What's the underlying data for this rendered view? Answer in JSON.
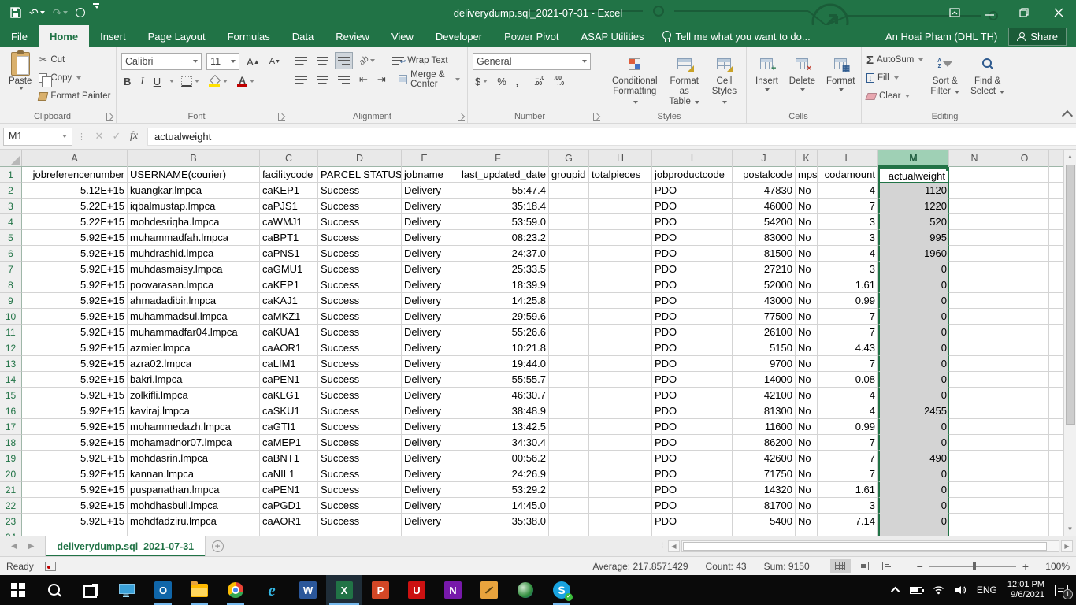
{
  "titlebar": {
    "title": "deliverydump.sql_2021-07-31 - Excel"
  },
  "menubar": {
    "tabs": [
      "File",
      "Home",
      "Insert",
      "Page Layout",
      "Formulas",
      "Data",
      "Review",
      "View",
      "Developer",
      "Power Pivot",
      "ASAP Utilities"
    ],
    "active_tab": "Home",
    "tell_me": "Tell me what you want to do...",
    "user_name": "An Hoai Pham (DHL TH)",
    "share_label": "Share"
  },
  "ribbon": {
    "clipboard": {
      "label": "Clipboard",
      "paste": "Paste",
      "cut": "Cut",
      "copy": "Copy",
      "format_painter": "Format Painter"
    },
    "font": {
      "label": "Font",
      "family": "Calibri",
      "size": "11"
    },
    "alignment": {
      "label": "Alignment",
      "wrap_text": "Wrap Text",
      "merge_center": "Merge & Center"
    },
    "number": {
      "label": "Number",
      "format": "General"
    },
    "styles": {
      "label": "Styles",
      "items": [
        {
          "l1": "Conditional",
          "l2": "Formatting"
        },
        {
          "l1": "Format as",
          "l2": "Table"
        },
        {
          "l1": "Cell",
          "l2": "Styles"
        }
      ]
    },
    "cells": {
      "label": "Cells",
      "items": [
        "Insert",
        "Delete",
        "Format"
      ]
    },
    "editing": {
      "label": "Editing",
      "autosum": "AutoSum",
      "fill": "Fill",
      "clear": "Clear",
      "sort": {
        "l1": "Sort &",
        "l2": "Filter"
      },
      "find": {
        "l1": "Find &",
        "l2": "Select"
      }
    }
  },
  "formula_bar": {
    "name_box": "M1",
    "value": "actualweight"
  },
  "grid": {
    "selected_column": "M",
    "columns": [
      {
        "letter": "A",
        "width": 134,
        "align": "right"
      },
      {
        "letter": "B",
        "width": 168,
        "align": "left"
      },
      {
        "letter": "C",
        "width": 74,
        "align": "left"
      },
      {
        "letter": "D",
        "width": 106,
        "align": "left"
      },
      {
        "letter": "E",
        "width": 58,
        "align": "left"
      },
      {
        "letter": "F",
        "width": 129,
        "align": "right"
      },
      {
        "letter": "G",
        "width": 51,
        "align": "left"
      },
      {
        "letter": "H",
        "width": 80,
        "align": "left"
      },
      {
        "letter": "I",
        "width": 102,
        "align": "left"
      },
      {
        "letter": "J",
        "width": 80,
        "align": "right"
      },
      {
        "letter": "K",
        "width": 28,
        "align": "left"
      },
      {
        "letter": "L",
        "width": 77,
        "align": "right"
      },
      {
        "letter": "M",
        "width": 90,
        "align": "right"
      },
      {
        "letter": "N",
        "width": 65,
        "align": "left"
      },
      {
        "letter": "O",
        "width": 62,
        "align": "left"
      }
    ],
    "headers": [
      "jobreferencenumber",
      "USERNAME(courier)",
      "facilitycode",
      "PARCEL STATUS",
      "jobname",
      "last_updated_date",
      "groupid",
      "totalpieces",
      "jobproductcode",
      "postalcode",
      "mps",
      "codamount",
      "actualweight"
    ],
    "rows": [
      [
        "5.12E+15",
        "kuangkar.lmpca",
        "caKEP1",
        "Success",
        "Delivery",
        "55:47.4",
        "",
        "",
        "PDO",
        "47830",
        "No",
        "4",
        "1120"
      ],
      [
        "5.22E+15",
        "iqbalmustap.lmpca",
        "caPJS1",
        "Success",
        "Delivery",
        "35:18.4",
        "",
        "",
        "PDO",
        "46000",
        "No",
        "7",
        "1220"
      ],
      [
        "5.22E+15",
        "mohdesriqha.lmpca",
        "caWMJ1",
        "Success",
        "Delivery",
        "53:59.0",
        "",
        "",
        "PDO",
        "54200",
        "No",
        "3",
        "520"
      ],
      [
        "5.92E+15",
        "muhammadfah.lmpca",
        "caBPT1",
        "Success",
        "Delivery",
        "08:23.2",
        "",
        "",
        "PDO",
        "83000",
        "No",
        "3",
        "995"
      ],
      [
        "5.92E+15",
        "muhdrashid.lmpca",
        "caPNS1",
        "Success",
        "Delivery",
        "24:37.0",
        "",
        "",
        "PDO",
        "81500",
        "No",
        "4",
        "1960"
      ],
      [
        "5.92E+15",
        "muhdasmaisy.lmpca",
        "caGMU1",
        "Success",
        "Delivery",
        "25:33.5",
        "",
        "",
        "PDO",
        "27210",
        "No",
        "3",
        "0"
      ],
      [
        "5.92E+15",
        "poovarasan.lmpca",
        "caKEP1",
        "Success",
        "Delivery",
        "18:39.9",
        "",
        "",
        "PDO",
        "52000",
        "No",
        "1.61",
        "0"
      ],
      [
        "5.92E+15",
        "ahmadadibir.lmpca",
        "caKAJ1",
        "Success",
        "Delivery",
        "14:25.8",
        "",
        "",
        "PDO",
        "43000",
        "No",
        "0.99",
        "0"
      ],
      [
        "5.92E+15",
        "muhammadsul.lmpca",
        "caMKZ1",
        "Success",
        "Delivery",
        "29:59.6",
        "",
        "",
        "PDO",
        "77500",
        "No",
        "7",
        "0"
      ],
      [
        "5.92E+15",
        "muhammadfar04.lmpca",
        "caKUA1",
        "Success",
        "Delivery",
        "55:26.6",
        "",
        "",
        "PDO",
        "26100",
        "No",
        "7",
        "0"
      ],
      [
        "5.92E+15",
        "azmier.lmpca",
        "caAOR1",
        "Success",
        "Delivery",
        "10:21.8",
        "",
        "",
        "PDO",
        "5150",
        "No",
        "4.43",
        "0"
      ],
      [
        "5.92E+15",
        "azra02.lmpca",
        "caLIM1",
        "Success",
        "Delivery",
        "19:44.0",
        "",
        "",
        "PDO",
        "9700",
        "No",
        "7",
        "0"
      ],
      [
        "5.92E+15",
        "bakri.lmpca",
        "caPEN1",
        "Success",
        "Delivery",
        "55:55.7",
        "",
        "",
        "PDO",
        "14000",
        "No",
        "0.08",
        "0"
      ],
      [
        "5.92E+15",
        "zolkifli.lmpca",
        "caKLG1",
        "Success",
        "Delivery",
        "46:30.7",
        "",
        "",
        "PDO",
        "42100",
        "No",
        "4",
        "0"
      ],
      [
        "5.92E+15",
        "kaviraj.lmpca",
        "caSKU1",
        "Success",
        "Delivery",
        "38:48.9",
        "",
        "",
        "PDO",
        "81300",
        "No",
        "4",
        "2455"
      ],
      [
        "5.92E+15",
        "mohammedazh.lmpca",
        "caGTI1",
        "Success",
        "Delivery",
        "13:42.5",
        "",
        "",
        "PDO",
        "11600",
        "No",
        "0.99",
        "0"
      ],
      [
        "5.92E+15",
        "mohamadnor07.lmpca",
        "caMEP1",
        "Success",
        "Delivery",
        "34:30.4",
        "",
        "",
        "PDO",
        "86200",
        "No",
        "7",
        "0"
      ],
      [
        "5.92E+15",
        "mohdasrin.lmpca",
        "caBNT1",
        "Success",
        "Delivery",
        "00:56.2",
        "",
        "",
        "PDO",
        "42600",
        "No",
        "7",
        "490"
      ],
      [
        "5.92E+15",
        "kannan.lmpca",
        "caNIL1",
        "Success",
        "Delivery",
        "24:26.9",
        "",
        "",
        "PDO",
        "71750",
        "No",
        "7",
        "0"
      ],
      [
        "5.92E+15",
        "puspanathan.lmpca",
        "caPEN1",
        "Success",
        "Delivery",
        "53:29.2",
        "",
        "",
        "PDO",
        "14320",
        "No",
        "1.61",
        "0"
      ],
      [
        "5.92E+15",
        "mohdhasbull.lmpca",
        "caPGD1",
        "Success",
        "Delivery",
        "14:45.0",
        "",
        "",
        "PDO",
        "81700",
        "No",
        "3",
        "0"
      ],
      [
        "5.92E+15",
        "mohdfadziru.lmpca",
        "caAOR1",
        "Success",
        "Delivery",
        "35:38.0",
        "",
        "",
        "PDO",
        "5400",
        "No",
        "7.14",
        "0"
      ]
    ]
  },
  "sheet_bar": {
    "tab": "deliverydump.sql_2021-07-31"
  },
  "status_bar": {
    "mode": "Ready",
    "average": "Average: 217.8571429",
    "count": "Count: 43",
    "sum": "Sum: 9150",
    "zoom": "100%"
  },
  "taskbar": {
    "icons": [
      {
        "name": "start-icon",
        "style": "startico",
        "running": false
      },
      {
        "name": "search-icon",
        "style": "searchico",
        "running": false
      },
      {
        "name": "task-view-icon",
        "style": "taskviewico",
        "running": false
      },
      {
        "name": "remote-desktop-icon",
        "style": "monitorico",
        "running": false
      },
      {
        "name": "outlook-icon",
        "style": "tile outlook",
        "letter": "O",
        "running": true
      },
      {
        "name": "file-explorer-icon",
        "style": "folderico",
        "running": true
      },
      {
        "name": "chrome-icon",
        "style": "chromeico",
        "running": true
      },
      {
        "name": "internet-explorer-icon",
        "style": "ieico",
        "letter": "e",
        "running": false
      },
      {
        "name": "word-icon",
        "style": "tile word",
        "letter": "W",
        "running": false
      },
      {
        "name": "excel-icon",
        "style": "tile excel",
        "letter": "X",
        "running": true,
        "focused": true
      },
      {
        "name": "powerpoint-icon",
        "style": "tile powerpoint",
        "letter": "P",
        "running": false
      },
      {
        "name": "unikey-icon",
        "style": "tile unikey",
        "letter": "U",
        "running": false
      },
      {
        "name": "onenote-icon",
        "style": "tile onenote",
        "letter": "N",
        "running": false
      },
      {
        "name": "snagit-icon",
        "style": "tile tools",
        "running": false
      },
      {
        "name": "cisco-anyconnect-icon",
        "style": "globeico",
        "running": false
      },
      {
        "name": "skype-icon",
        "style": "skypeico",
        "letter": "S",
        "running": true
      }
    ],
    "tray": {
      "lang": "ENG",
      "time": "12:01 PM",
      "date": "9/6/2021",
      "badge": "1"
    }
  },
  "colors": {
    "excel_green": "#217346",
    "selection_fill": "#d4d4d4",
    "selected_header": "#9fd0b5"
  }
}
